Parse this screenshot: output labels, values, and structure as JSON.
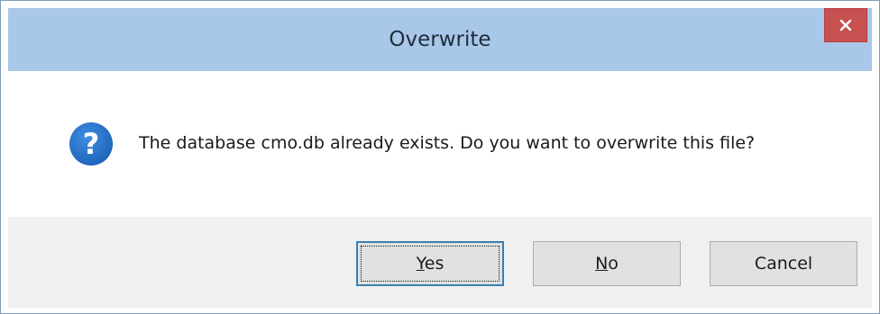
{
  "dialog": {
    "title": "Overwrite",
    "message": "The database cmo.db already exists. Do you want to overwrite this file?",
    "icon": "question-icon"
  },
  "titlebar": {
    "close_icon": "close-icon",
    "close_color": "#c75050"
  },
  "buttons": {
    "yes": {
      "mnemonic": "Y",
      "rest": "es",
      "is_default": true
    },
    "no": {
      "mnemonic": "N",
      "rest": "o"
    },
    "cancel": {
      "label": "Cancel"
    }
  },
  "colors": {
    "titlebar": "#a9c7e8",
    "icon_blue": "#2a6fc9",
    "buttonbar": "#f0f0f0"
  }
}
